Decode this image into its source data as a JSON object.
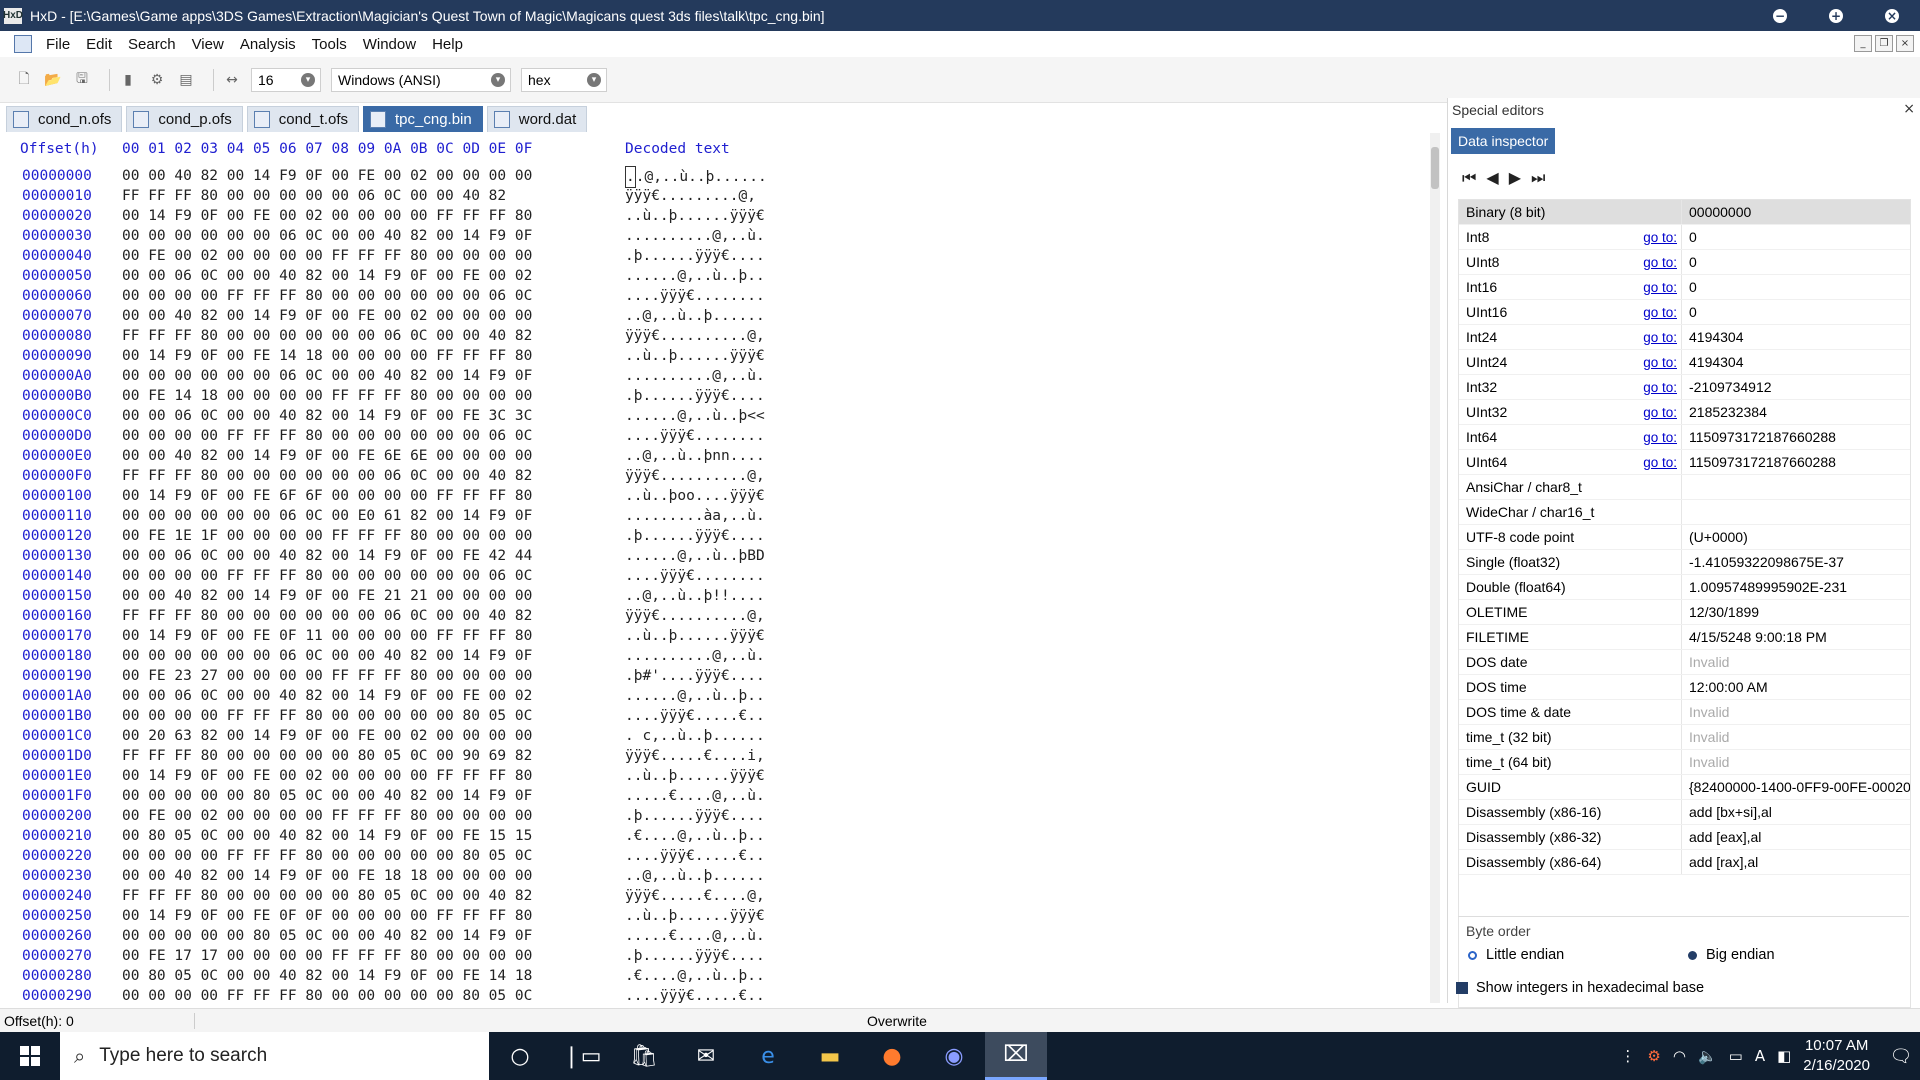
{
  "window": {
    "title": "HxD - [E:\\Games\\Game apps\\3DS Games\\Extraction\\Magician's Quest Town of Magic\\Magicans quest 3ds files\\talk\\tpc_cng.bin]",
    "app_icon_text": "HxD"
  },
  "menu": [
    "File",
    "Edit",
    "Search",
    "View",
    "Analysis",
    "Tools",
    "Window",
    "Help"
  ],
  "toolbar": {
    "bytes_per_row": "16",
    "charset": "Windows (ANSI)",
    "display_mode": "hex"
  },
  "tabs": [
    {
      "label": "cond_n.ofs",
      "active": false
    },
    {
      "label": "cond_p.ofs",
      "active": false
    },
    {
      "label": "cond_t.ofs",
      "active": false
    },
    {
      "label": "tpc_cng.bin",
      "active": true
    },
    {
      "label": "word.dat",
      "active": false
    }
  ],
  "hex_header": {
    "offset": "Offset(h)",
    "columns": "00 01 02 03 04 05 06 07 08 09 0A 0B 0C 0D 0E 0F",
    "decoded": "Decoded text"
  },
  "hex_rows": [
    {
      "offset": "00000000",
      "hex": "00 00 40 82 00 14 F9 0F 00 FE 00 02 00 00 00 00",
      "text": ".@,..ù..þ......",
      "cursor": "."
    },
    {
      "offset": "00000010",
      "hex": "FF FF FF 80 00 00 00 00 00 06 0C 00 00 40 82",
      "text": "ÿÿÿ€.........@,"
    },
    {
      "offset": "00000020",
      "hex": "00 14 F9 0F 00 FE 00 02 00 00 00 00 FF FF FF 80",
      "text": "..ù..þ......ÿÿÿ€"
    },
    {
      "offset": "00000030",
      "hex": "00 00 00 00 00 00 06 0C 00 00 40 82 00 14 F9 0F",
      "text": "..........@,..ù."
    },
    {
      "offset": "00000040",
      "hex": "00 FE 00 02 00 00 00 00 FF FF FF 80 00 00 00 00",
      "text": ".þ......ÿÿÿ€...."
    },
    {
      "offset": "00000050",
      "hex": "00 00 06 0C 00 00 40 82 00 14 F9 0F 00 FE 00 02",
      "text": "......@,..ù..þ.."
    },
    {
      "offset": "00000060",
      "hex": "00 00 00 00 FF FF FF 80 00 00 00 00 00 00 06 0C",
      "text": "....ÿÿÿ€........"
    },
    {
      "offset": "00000070",
      "hex": "00 00 40 82 00 14 F9 0F 00 FE 00 02 00 00 00 00",
      "text": "..@,..ù..þ......"
    },
    {
      "offset": "00000080",
      "hex": "FF FF FF 80 00 00 00 00 00 00 06 0C 00 00 40 82",
      "text": "ÿÿÿ€..........@,"
    },
    {
      "offset": "00000090",
      "hex": "00 14 F9 0F 00 FE 14 18 00 00 00 00 FF FF FF 80",
      "text": "..ù..þ......ÿÿÿ€"
    },
    {
      "offset": "000000A0",
      "hex": "00 00 00 00 00 00 06 0C 00 00 40 82 00 14 F9 0F",
      "text": "..........@,..ù."
    },
    {
      "offset": "000000B0",
      "hex": "00 FE 14 18 00 00 00 00 FF FF FF 80 00 00 00 00",
      "text": ".þ......ÿÿÿ€...."
    },
    {
      "offset": "000000C0",
      "hex": "00 00 06 0C 00 00 40 82 00 14 F9 0F 00 FE 3C 3C",
      "text": "......@,..ù..þ<<"
    },
    {
      "offset": "000000D0",
      "hex": "00 00 00 00 FF FF FF 80 00 00 00 00 00 00 06 0C",
      "text": "....ÿÿÿ€........"
    },
    {
      "offset": "000000E0",
      "hex": "00 00 40 82 00 14 F9 0F 00 FE 6E 6E 00 00 00 00",
      "text": "..@,..ù..þnn...."
    },
    {
      "offset": "000000F0",
      "hex": "FF FF FF 80 00 00 00 00 00 00 06 0C 00 00 40 82",
      "text": "ÿÿÿ€..........@,"
    },
    {
      "offset": "00000100",
      "hex": "00 14 F9 0F 00 FE 6F 6F 00 00 00 00 FF FF FF 80",
      "text": "..ù..þoo....ÿÿÿ€"
    },
    {
      "offset": "00000110",
      "hex": "00 00 00 00 00 00 06 0C 00 E0 61 82 00 14 F9 0F",
      "text": ".........àa,..ù."
    },
    {
      "offset": "00000120",
      "hex": "00 FE 1E 1F 00 00 00 00 FF FF FF 80 00 00 00 00",
      "text": ".þ......ÿÿÿ€...."
    },
    {
      "offset": "00000130",
      "hex": "00 00 06 0C 00 00 40 82 00 14 F9 0F 00 FE 42 44",
      "text": "......@,..ù..þBD"
    },
    {
      "offset": "00000140",
      "hex": "00 00 00 00 FF FF FF 80 00 00 00 00 00 00 06 0C",
      "text": "....ÿÿÿ€........"
    },
    {
      "offset": "00000150",
      "hex": "00 00 40 82 00 14 F9 0F 00 FE 21 21 00 00 00 00",
      "text": "..@,..ù..þ!!...."
    },
    {
      "offset": "00000160",
      "hex": "FF FF FF 80 00 00 00 00 00 00 06 0C 00 00 40 82",
      "text": "ÿÿÿ€..........@,"
    },
    {
      "offset": "00000170",
      "hex": "00 14 F9 0F 00 FE 0F 11 00 00 00 00 FF FF FF 80",
      "text": "..ù..þ......ÿÿÿ€"
    },
    {
      "offset": "00000180",
      "hex": "00 00 00 00 00 00 06 0C 00 00 40 82 00 14 F9 0F",
      "text": "..........@,..ù."
    },
    {
      "offset": "00000190",
      "hex": "00 FE 23 27 00 00 00 00 FF FF FF 80 00 00 00 00",
      "text": ".þ#'....ÿÿÿ€...."
    },
    {
      "offset": "000001A0",
      "hex": "00 00 06 0C 00 00 40 82 00 14 F9 0F 00 FE 00 02",
      "text": "......@,..ù..þ.."
    },
    {
      "offset": "000001B0",
      "hex": "00 00 00 00 FF FF FF 80 00 00 00 00 00 80 05 0C",
      "text": "....ÿÿÿ€.....€.."
    },
    {
      "offset": "000001C0",
      "hex": "00 20 63 82 00 14 F9 0F 00 FE 00 02 00 00 00 00",
      "text": ". c,..ù..þ......"
    },
    {
      "offset": "000001D0",
      "hex": "FF FF FF 80 00 00 00 00 00 80 05 0C 00 90 69 82",
      "text": "ÿÿÿ€.....€....i,"
    },
    {
      "offset": "000001E0",
      "hex": "00 14 F9 0F 00 FE 00 02 00 00 00 00 FF FF FF 80",
      "text": "..ù..þ......ÿÿÿ€"
    },
    {
      "offset": "000001F0",
      "hex": "00 00 00 00 00 80 05 0C 00 00 40 82 00 14 F9 0F",
      "text": ".....€....@,..ù."
    },
    {
      "offset": "00000200",
      "hex": "00 FE 00 02 00 00 00 00 FF FF FF 80 00 00 00 00",
      "text": ".þ......ÿÿÿ€...."
    },
    {
      "offset": "00000210",
      "hex": "00 80 05 0C 00 00 40 82 00 14 F9 0F 00 FE 15 15",
      "text": ".€....@,..ù..þ.."
    },
    {
      "offset": "00000220",
      "hex": "00 00 00 00 FF FF FF 80 00 00 00 00 00 80 05 0C",
      "text": "....ÿÿÿ€.....€.."
    },
    {
      "offset": "00000230",
      "hex": "00 00 40 82 00 14 F9 0F 00 FE 18 18 00 00 00 00",
      "text": "..@,..ù..þ......"
    },
    {
      "offset": "00000240",
      "hex": "FF FF FF 80 00 00 00 00 00 80 05 0C 00 00 40 82",
      "text": "ÿÿÿ€.....€....@,"
    },
    {
      "offset": "00000250",
      "hex": "00 14 F9 0F 00 FE 0F 0F 00 00 00 00 FF FF FF 80",
      "text": "..ù..þ......ÿÿÿ€"
    },
    {
      "offset": "00000260",
      "hex": "00 00 00 00 00 80 05 0C 00 00 40 82 00 14 F9 0F",
      "text": ".....€....@,..ù."
    },
    {
      "offset": "00000270",
      "hex": "00 FE 17 17 00 00 00 00 FF FF FF 80 00 00 00 00",
      "text": ".þ......ÿÿÿ€...."
    },
    {
      "offset": "00000280",
      "hex": "00 80 05 0C 00 00 40 82 00 14 F9 0F 00 FE 14 18",
      "text": ".€....@,..ù..þ.."
    },
    {
      "offset": "00000290",
      "hex": "00 00 00 00 FF FF FF 80 00 00 00 00 00 80 05 0C",
      "text": "....ÿÿÿ€.....€.."
    }
  ],
  "special_editors": {
    "title": "Special editors",
    "tab": "Data inspector",
    "goto_label": "go to:",
    "rows": [
      {
        "name": "Binary (8 bit)",
        "goto": false,
        "value": "00000000",
        "highlight": true
      },
      {
        "name": "Int8",
        "goto": true,
        "value": "0"
      },
      {
        "name": "UInt8",
        "goto": true,
        "value": "0"
      },
      {
        "name": "Int16",
        "goto": true,
        "value": "0"
      },
      {
        "name": "UInt16",
        "goto": true,
        "value": "0"
      },
      {
        "name": "Int24",
        "goto": true,
        "value": "4194304"
      },
      {
        "name": "UInt24",
        "goto": true,
        "value": "4194304"
      },
      {
        "name": "Int32",
        "goto": true,
        "value": "-2109734912"
      },
      {
        "name": "UInt32",
        "goto": true,
        "value": "2185232384"
      },
      {
        "name": "Int64",
        "goto": true,
        "value": "1150973172187660288"
      },
      {
        "name": "UInt64",
        "goto": true,
        "value": "1150973172187660288"
      },
      {
        "name": "AnsiChar / char8_t",
        "goto": false,
        "value": ""
      },
      {
        "name": "WideChar / char16_t",
        "goto": false,
        "value": ""
      },
      {
        "name": "UTF-8 code point",
        "goto": false,
        "value": " (U+0000)"
      },
      {
        "name": "Single (float32)",
        "goto": false,
        "value": "-1.41059322098675E-37"
      },
      {
        "name": "Double (float64)",
        "goto": false,
        "value": "1.00957489995902E-231"
      },
      {
        "name": "OLETIME",
        "goto": false,
        "value": "12/30/1899"
      },
      {
        "name": "FILETIME",
        "goto": false,
        "value": "4/15/5248 9:00:18 PM"
      },
      {
        "name": "DOS date",
        "goto": false,
        "value": "Invalid",
        "invalid": true
      },
      {
        "name": "DOS time",
        "goto": false,
        "value": "12:00:00 AM"
      },
      {
        "name": "DOS time & date",
        "goto": false,
        "value": "Invalid",
        "invalid": true
      },
      {
        "name": "time_t (32 bit)",
        "goto": false,
        "value": "Invalid",
        "invalid": true
      },
      {
        "name": "time_t (64 bit)",
        "goto": false,
        "value": "Invalid",
        "invalid": true
      },
      {
        "name": "GUID",
        "goto": false,
        "value": "{82400000-1400-0FF9-00FE-00020"
      },
      {
        "name": "Disassembly (x86-16)",
        "goto": false,
        "value": "add [bx+si],al"
      },
      {
        "name": "Disassembly (x86-32)",
        "goto": false,
        "value": "add [eax],al"
      },
      {
        "name": "Disassembly (x86-64)",
        "goto": false,
        "value": "add [rax],al"
      }
    ],
    "byte_order_title": "Byte order",
    "little_endian": "Little endian",
    "big_endian": "Big endian",
    "selected_order": "big",
    "show_hex": "Show integers in hexadecimal base"
  },
  "status": {
    "offset": "Offset(h): 0",
    "mode": "Overwrite"
  },
  "taskbar": {
    "search_placeholder": "Type here to search",
    "time": "10:07 AM",
    "date": "2/16/2020"
  },
  "colors": {
    "titlebar": "#243a5c",
    "accent": "#3a6aa6",
    "offset_blue": "#1f1fd0"
  }
}
